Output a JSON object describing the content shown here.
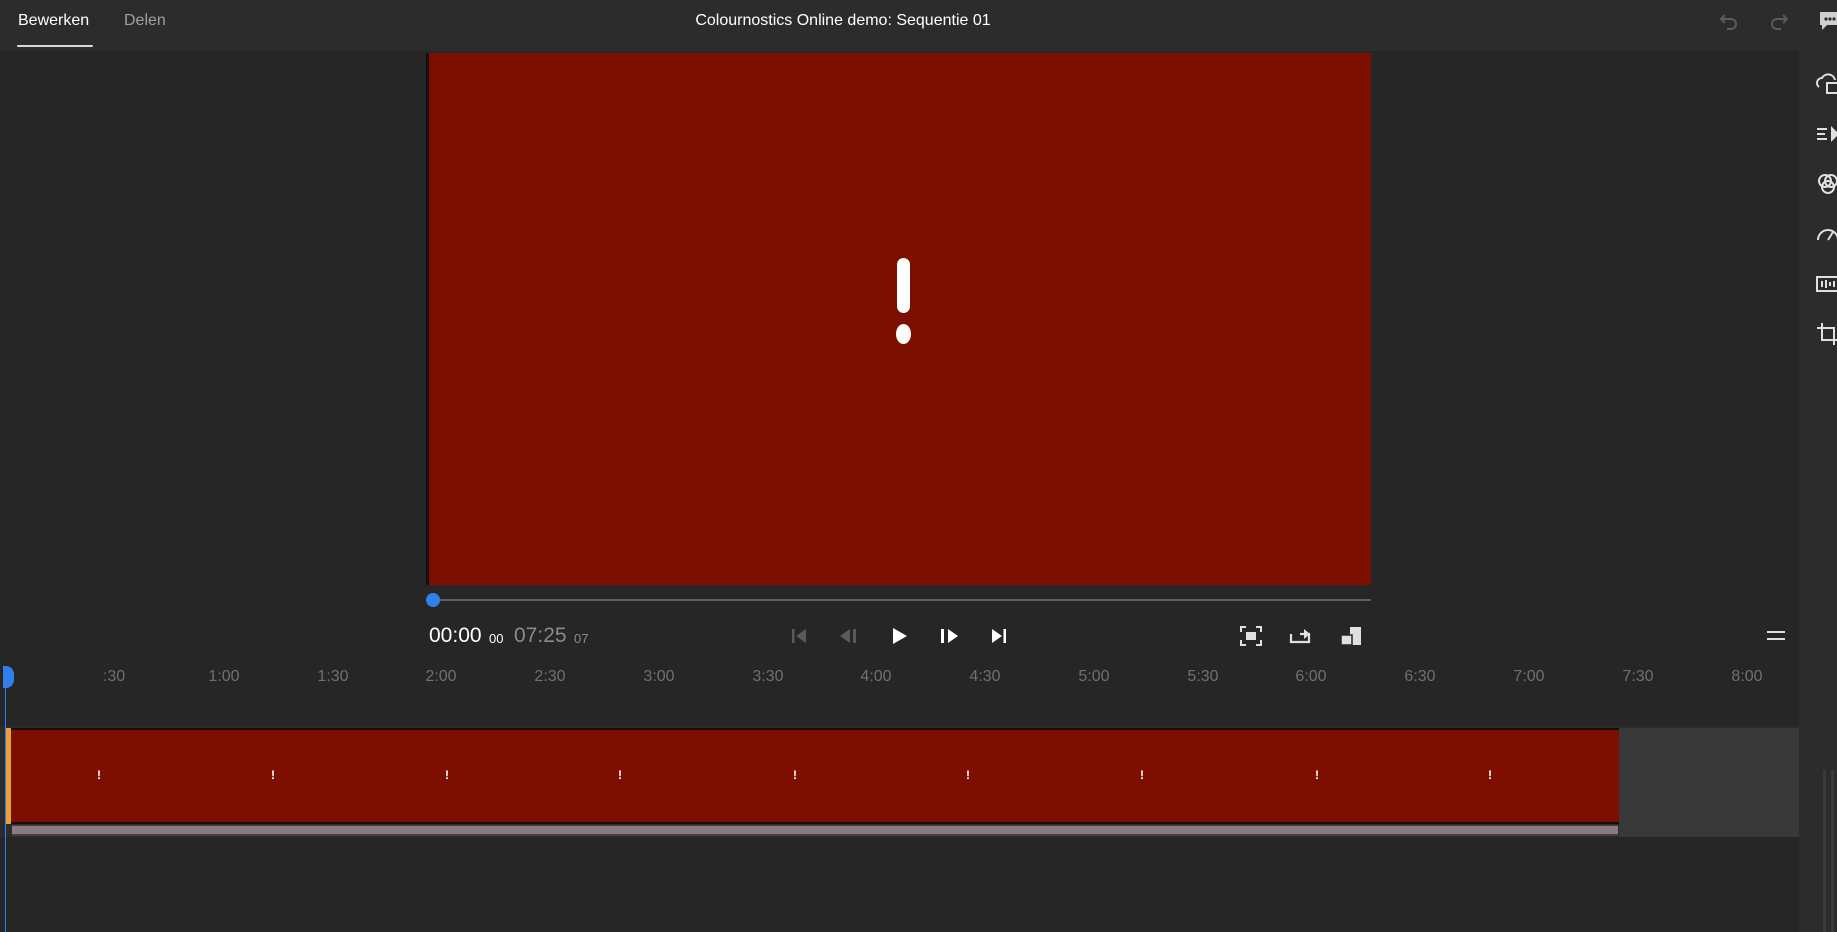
{
  "topbar": {
    "tabs": [
      {
        "label": "Bewerken",
        "active": true
      },
      {
        "label": "Delen",
        "active": false
      }
    ],
    "title": "Colournostics Online demo: Sequentie 01",
    "undo_icon": "undo-icon",
    "redo_icon": "redo-icon",
    "comment_icon": "comment-icon"
  },
  "right_rail": {
    "icons": [
      "export-cloud-icon",
      "transitions-icon",
      "color-icon",
      "speed-icon",
      "audio-icon",
      "crop-icon"
    ]
  },
  "preview": {
    "background_color": "#7d0f00",
    "overlay_icon": "exclamation-icon"
  },
  "playback": {
    "current_time": "00:00",
    "current_frames": "00",
    "total_time": "07:25",
    "total_frames": "07",
    "progress": 0,
    "controls": [
      "skip-to-start-icon",
      "step-back-icon",
      "play-icon",
      "step-forward-icon",
      "skip-to-end-icon"
    ],
    "view_controls": [
      "fit-frame-icon",
      "loop-icon",
      "aspect-ratio-icon"
    ],
    "menu_icon": "hamburger-menu-icon",
    "accent_color": "#2f80ed"
  },
  "timeline": {
    "ruler_labels": [
      ":30",
      "1:00",
      "1:30",
      "2:00",
      "2:30",
      "3:00",
      "3:30",
      "4:00",
      "4:30",
      "5:00",
      "5:30",
      "6:00",
      "6:30",
      "7:00",
      "7:30",
      "8:00"
    ],
    "clip": {
      "color": "#7d0f00",
      "handle_color": "#e8a13a",
      "warning_marker": "!",
      "warning_count": 9
    }
  }
}
